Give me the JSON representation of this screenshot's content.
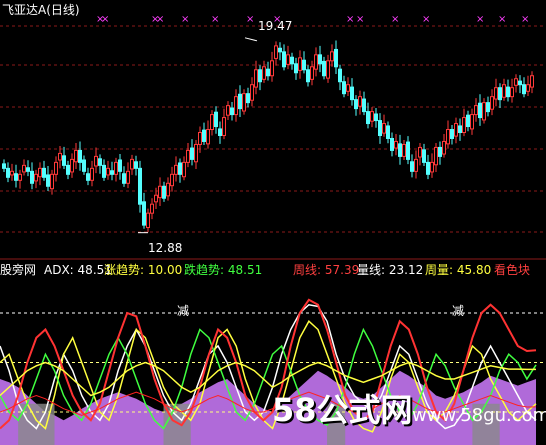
{
  "header": {
    "stock_name": "飞亚达A",
    "period": "(日线)"
  },
  "indicator_header": {
    "source": "股旁网",
    "adx_label": "ADX:",
    "adx_value": "48.51",
    "up_label": "涨趋势:",
    "up_value": "10.00",
    "down_label": "跌趋势:",
    "down_value": "48.51",
    "week_label": "周线:",
    "week_value": "57.39",
    "volume_label": "量线:",
    "volume_value": "23.12",
    "week_vol_label": "周量:",
    "week_vol_value": "45.80",
    "color_hint": "看色块"
  },
  "annotations": {
    "reduce_1": "减",
    "reduce_2": "减"
  },
  "watermark": {
    "brand": "58公式网",
    "url": "www.58gu.com"
  },
  "colors": {
    "background": "#000000",
    "up_candle": "#ff3a3a",
    "down_candle": "#54ffff",
    "signal_x": "#ff40ff",
    "grid": "#8b1a1a",
    "adx": "#ffffff",
    "up_trend": "#ffff40",
    "down_trend": "#40ff40",
    "week_line": "#ff3333",
    "volume_line": "#ffffff",
    "week_volume": "#ffff40",
    "color_block": "#cf7cff",
    "color_block_dark": "#8a8a8a"
  },
  "chart_data": [
    {
      "type": "candlestick",
      "title": "飞亚达A (日线)",
      "ylim": [
        12.3,
        20.2
      ],
      "max_label": "19.47",
      "min_label": "12.88",
      "signal_marks_count": 14,
      "closes": [
        15.1,
        14.8,
        15.0,
        14.7,
        14.9,
        15.2,
        15.0,
        14.6,
        14.9,
        15.1,
        14.8,
        14.5,
        14.9,
        15.3,
        15.6,
        15.2,
        14.9,
        15.4,
        15.7,
        15.3,
        15.0,
        14.7,
        15.1,
        15.5,
        15.2,
        14.8,
        15.1,
        14.9,
        15.3,
        15.0,
        14.6,
        15.0,
        15.4,
        15.1,
        13.9,
        13.2,
        13.6,
        13.9,
        14.2,
        14.5,
        14.1,
        14.6,
        14.9,
        15.2,
        14.9,
        15.3,
        15.7,
        15.4,
        15.9,
        16.3,
        16.0,
        16.4,
        16.9,
        16.5,
        16.2,
        16.8,
        17.2,
        16.9,
        17.5,
        17.1,
        17.6,
        17.3,
        17.9,
        18.4,
        18.0,
        18.5,
        18.2,
        18.7,
        19.2,
        19.0,
        18.5,
        18.9,
        18.6,
        18.3,
        18.8,
        18.4,
        18.0,
        18.5,
        18.9,
        18.6,
        18.2,
        18.7,
        19.0,
        18.5,
        18.0,
        17.6,
        17.9,
        17.4,
        17.1,
        17.5,
        17.0,
        16.6,
        17.0,
        16.7,
        16.2,
        16.6,
        16.1,
        15.7,
        16.0,
        15.5,
        15.9,
        15.4,
        15.0,
        15.4,
        15.8,
        15.3,
        14.9,
        15.3,
        15.8,
        15.5,
        16.0,
        16.4,
        16.1,
        16.6,
        16.3,
        16.8,
        16.5,
        16.9,
        17.2,
        16.8,
        17.3,
        17.0,
        17.5,
        17.8,
        17.4,
        17.9,
        17.5,
        17.8,
        18.1,
        17.9,
        17.6,
        17.9,
        18.2
      ]
    },
    {
      "type": "line",
      "title": "ADX",
      "ylim": [
        0,
        100
      ],
      "reference_lines": [
        80,
        50,
        20
      ],
      "series": [
        {
          "name": "ADX",
          "values": [
            60,
            45,
            25,
            15,
            10,
            20,
            40,
            55,
            45,
            30,
            20,
            15,
            25,
            45,
            60,
            70,
            60,
            45,
            30,
            20,
            15,
            25,
            40,
            55,
            60,
            50,
            35,
            20,
            15,
            20,
            35,
            55,
            70,
            80,
            85,
            84,
            75,
            55,
            40,
            30,
            25,
            20,
            30,
            45,
            60,
            55,
            40,
            25,
            15,
            10,
            12,
            20,
            35,
            50,
            60,
            50,
            40,
            30,
            20,
            15
          ]
        },
        {
          "name": "涨趋势",
          "values": [
            50,
            55,
            40,
            25,
            15,
            10,
            30,
            55,
            65,
            50,
            35,
            20,
            15,
            30,
            50,
            70,
            65,
            50,
            35,
            25,
            20,
            15,
            25,
            45,
            65,
            70,
            60,
            40,
            25,
            15,
            10,
            25,
            45,
            65,
            75,
            70,
            55,
            40,
            25,
            15,
            10,
            8,
            20,
            40,
            55,
            50,
            35,
            20,
            15,
            20,
            30,
            45,
            60,
            55,
            40,
            30,
            20,
            15,
            20,
            25
          ]
        },
        {
          "name": "跌趋势",
          "values": [
            30,
            20,
            15,
            25,
            40,
            55,
            45,
            30,
            20,
            15,
            25,
            40,
            55,
            65,
            55,
            40,
            25,
            15,
            10,
            20,
            35,
            55,
            70,
            65,
            50,
            35,
            20,
            15,
            25,
            40,
            55,
            60,
            45,
            30,
            20,
            15,
            12,
            20,
            35,
            55,
            70,
            60,
            45,
            30,
            20,
            15,
            25,
            40,
            55,
            48,
            35,
            25,
            15,
            20,
            30,
            45,
            55,
            50,
            40,
            48.51
          ]
        },
        {
          "name": "周线",
          "values": [
            10,
            15,
            30,
            50,
            65,
            70,
            60,
            45,
            30,
            20,
            15,
            25,
            45,
            65,
            80,
            78,
            60,
            40,
            25,
            15,
            12,
            20,
            35,
            55,
            70,
            65,
            50,
            30,
            20,
            15,
            20,
            35,
            60,
            80,
            88,
            85,
            70,
            50,
            30,
            20,
            15,
            20,
            40,
            60,
            75,
            70,
            55,
            35,
            20,
            15,
            25,
            45,
            65,
            80,
            85,
            80,
            70,
            60,
            57,
            57.39
          ]
        },
        {
          "name": "量线",
          "values": [
            20,
            22,
            25,
            28,
            30,
            28,
            25,
            22,
            20,
            18,
            20,
            22,
            25,
            28,
            30,
            32,
            30,
            28,
            25,
            22,
            20,
            22,
            25,
            28,
            30,
            28,
            25,
            22,
            20,
            20,
            22,
            25,
            28,
            30,
            32,
            30,
            28,
            25,
            22,
            20,
            20,
            22,
            25,
            28,
            30,
            28,
            25,
            22,
            20,
            20,
            22,
            24,
            26,
            28,
            30,
            28,
            26,
            24,
            23,
            23.12
          ]
        },
        {
          "name": "周量",
          "values": [
            30,
            35,
            40,
            45,
            48,
            50,
            48,
            45,
            40,
            35,
            30,
            32,
            35,
            40,
            45,
            48,
            50,
            48,
            45,
            40,
            35,
            32,
            35,
            40,
            45,
            48,
            50,
            48,
            45,
            40,
            35,
            38,
            42,
            45,
            48,
            50,
            48,
            45,
            42,
            40,
            38,
            40,
            42,
            45,
            48,
            50,
            48,
            45,
            42,
            40,
            40,
            42,
            44,
            46,
            48,
            47,
            46,
            46,
            45.8,
            45.8
          ]
        }
      ],
      "color_block": [
        40,
        38,
        35,
        30,
        25,
        20,
        18,
        15,
        18,
        22,
        25,
        28,
        30,
        32,
        30,
        28,
        25,
        22,
        20,
        22,
        25,
        28,
        32,
        35,
        38,
        40,
        35,
        30,
        25,
        22,
        20,
        25,
        30,
        35,
        40,
        45,
        42,
        38,
        35,
        30,
        28,
        30,
        35,
        40,
        45,
        42,
        38,
        35,
        30,
        28,
        30,
        32,
        35,
        38,
        42,
        40,
        38,
        36,
        38,
        40
      ],
      "ADX": 48.51,
      "涨趋势": 10.0,
      "跌趋势": 48.51,
      "周线": 57.39,
      "量线": 23.12,
      "周量": 45.8
    }
  ]
}
